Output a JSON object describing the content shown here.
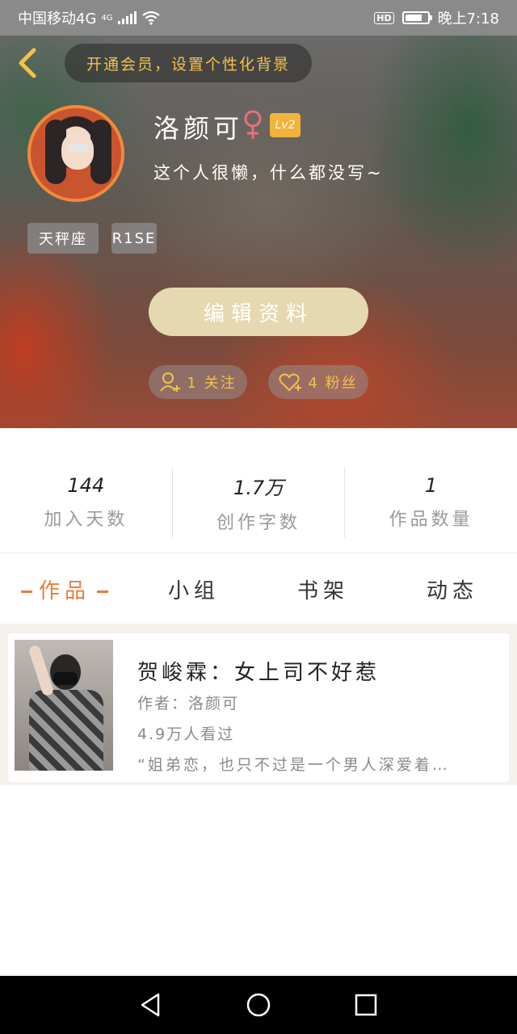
{
  "status_bar": {
    "carrier": "中国移动4G",
    "network_label": "4G",
    "hd_label": "HD",
    "time": "晚上7:18"
  },
  "header": {
    "vip_prompt": "开通会员，设置个性化背景",
    "username": "洛颜可",
    "level": "Lv2",
    "bio": "这个人很懒，什么都没写~",
    "tags": [
      "天秤座",
      "R1SE"
    ],
    "edit_button": "编辑资料",
    "following_label": "1 关注",
    "fans_label": "4 粉丝"
  },
  "stats": [
    {
      "value": "144",
      "label": "加入天数"
    },
    {
      "value": "1.7万",
      "label": "创作字数"
    },
    {
      "value": "1",
      "label": "作品数量"
    }
  ],
  "tabs": [
    {
      "label": "作品",
      "active": true
    },
    {
      "label": "小组",
      "active": false
    },
    {
      "label": "书架",
      "active": false
    },
    {
      "label": "动态",
      "active": false
    }
  ],
  "works": [
    {
      "title": "贺峻霖：女上司不好惹",
      "author": "作者：洛颜可",
      "views": "4.9万人看过",
      "excerpt": "“姐弟恋，也只不过是一个男人深爱着…"
    }
  ],
  "colors": {
    "accent_orange": "#ea7a3d",
    "gold": "#f3c24a",
    "edit_button_bg": "#e6d8b0"
  }
}
